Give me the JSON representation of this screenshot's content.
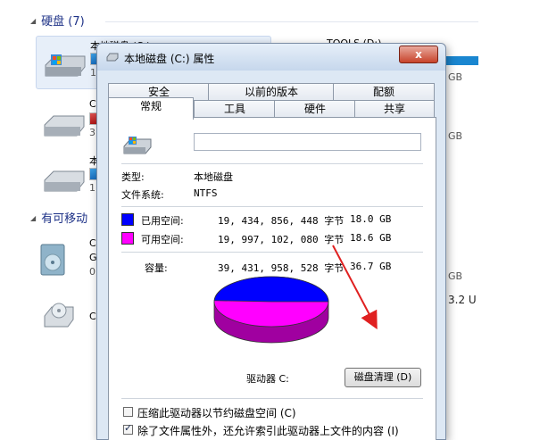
{
  "explorer": {
    "hard_disk_group": "硬盘 (7)",
    "removable_group": "有可移动",
    "drives": [
      {
        "name": "本地磁盘 (C:)",
        "free_frag": "1"
      },
      {
        "name": "C",
        "free_frag": "3"
      },
      {
        "name": "本",
        "free_frag": "1"
      }
    ],
    "right_column": {
      "tools_label": "TOOLS (D:)",
      "gb_fragments": [
        "GB",
        "GB",
        "GB"
      ],
      "usb_fragment": "3.2 U"
    },
    "removable_items": [
      {
        "line1": "C",
        "line2": "G",
        "line3": "0"
      },
      {
        "line1": "C"
      }
    ]
  },
  "dialog": {
    "title": "本地磁盘 (C:) 属性",
    "close_label": "x",
    "tabs_back": [
      "安全",
      "以前的版本",
      "配额"
    ],
    "tabs_front": [
      "常规",
      "工具",
      "硬件",
      "共享"
    ],
    "drive_label_value": "",
    "type_label": "类型:",
    "type_value": "本地磁盘",
    "fs_label": "文件系统:",
    "fs_value": "NTFS",
    "used_label": "已用空间:",
    "used_bytes": "19, 434, 856, 448 字节",
    "used_gb": "18.0 GB",
    "free_label": "可用空间:",
    "free_bytes": "19, 997, 102, 080 字节",
    "free_gb": "18.6 GB",
    "capacity_label": "容量:",
    "capacity_bytes": "39, 431, 958, 528 字节",
    "capacity_gb": "36.7 GB",
    "drive_caption": "驱动器 C:",
    "cleanup_button": "磁盘清理 (D)",
    "compress_label": "压缩此驱动器以节约磁盘空间 (C)",
    "compress_checked": false,
    "index_label": "除了文件属性外，还允许索引此驱动器上文件的内容 (I)",
    "index_checked": true,
    "colors": {
      "used": "#0000ff",
      "free": "#ff00ff",
      "arrow": "#e02020"
    }
  }
}
